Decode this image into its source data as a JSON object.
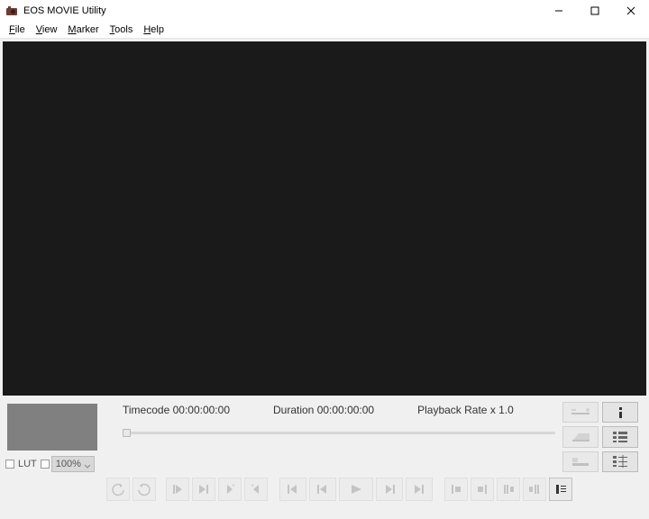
{
  "window": {
    "title": "EOS MOVIE Utility"
  },
  "menu": {
    "file": "File",
    "view": "View",
    "marker": "Marker",
    "tools": "Tools",
    "help": "Help"
  },
  "lut": {
    "label": "LUT",
    "zoom_value": "100%"
  },
  "info": {
    "timecode_label": "Timecode",
    "timecode_value": "00:00:00:00",
    "duration_label": "Duration",
    "duration_value": "00:00:00:00",
    "rate_label": "Playback Rate x",
    "rate_value": "1.0"
  },
  "icons": {
    "minimize": "—",
    "maximize": "☐",
    "close": "✕"
  }
}
